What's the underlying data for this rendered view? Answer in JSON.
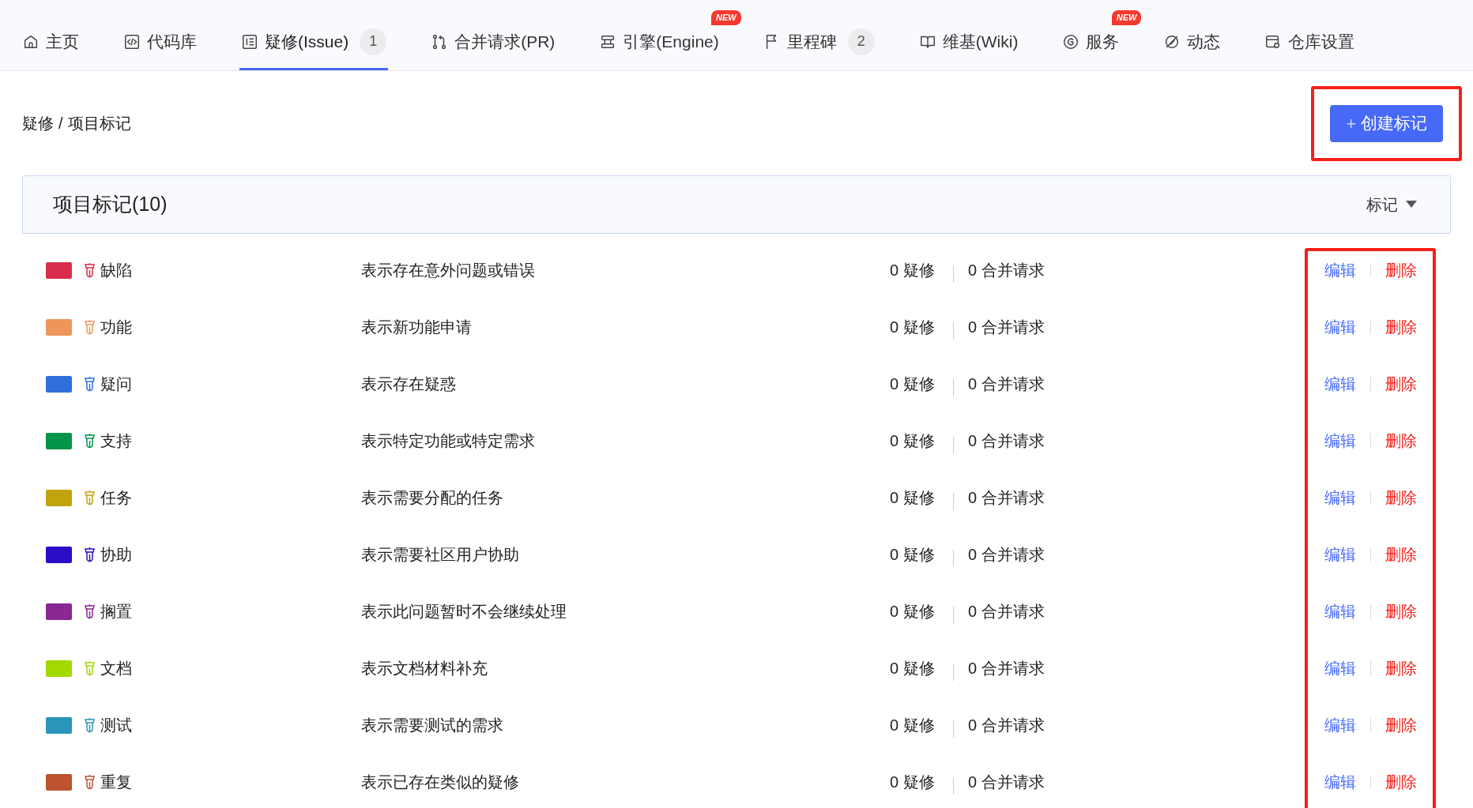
{
  "tabs": [
    {
      "kind": "home",
      "label": "主页",
      "selected": false
    },
    {
      "kind": "code",
      "label": "代码库",
      "selected": false
    },
    {
      "kind": "issue",
      "label": "疑修(Issue)",
      "badge": "1",
      "selected": true
    },
    {
      "kind": "pr",
      "label": "合并请求(PR)",
      "selected": false
    },
    {
      "kind": "engine",
      "label": "引擎(Engine)",
      "flag": "NEW",
      "selected": false
    },
    {
      "kind": "milestone",
      "label": "里程碑",
      "badge": "2",
      "selected": false
    },
    {
      "kind": "wiki",
      "label": "维基(Wiki)",
      "selected": false
    },
    {
      "kind": "service",
      "label": "服务",
      "flag": "NEW",
      "selected": false
    },
    {
      "kind": "activity",
      "label": "动态",
      "selected": false
    },
    {
      "kind": "settings",
      "label": "仓库设置",
      "selected": false
    }
  ],
  "breadcrumb": {
    "separator": "/",
    "items": [
      "疑修",
      "项目标记"
    ]
  },
  "create_button": {
    "icon": "+",
    "label": "创建标记"
  },
  "panel": {
    "title": "项目标记(10)",
    "sort": "标记"
  },
  "labels": [
    {
      "color": "#d92d4c",
      "name": "缺陷",
      "description": "表示存在意外问题或错误",
      "issues": "0 疑修",
      "prs": "0 合并请求",
      "edit": "编辑",
      "delete": "删除"
    },
    {
      "color": "#ee955a",
      "name": "功能",
      "description": "表示新功能申请",
      "issues": "0 疑修",
      "prs": "0 合并请求",
      "edit": "编辑",
      "delete": "删除"
    },
    {
      "color": "#2f6fdb",
      "name": "疑问",
      "description": "表示存在疑惑",
      "issues": "0 疑修",
      "prs": "0 合并请求",
      "edit": "编辑",
      "delete": "删除"
    },
    {
      "color": "#029448",
      "name": "支持",
      "description": "表示特定功能或特定需求",
      "issues": "0 疑修",
      "prs": "0 合并请求",
      "edit": "编辑",
      "delete": "删除"
    },
    {
      "color": "#c1a30d",
      "name": "任务",
      "description": "表示需要分配的任务",
      "issues": "0 疑修",
      "prs": "0 合并请求",
      "edit": "编辑",
      "delete": "删除"
    },
    {
      "color": "#2d0ec6",
      "name": "协助",
      "description": "表示需要社区用户协助",
      "issues": "0 疑修",
      "prs": "0 合并请求",
      "edit": "编辑",
      "delete": "删除"
    },
    {
      "color": "#892793",
      "name": "搁置",
      "description": "表示此问题暂时不会继续处理",
      "issues": "0 疑修",
      "prs": "0 合并请求",
      "edit": "编辑",
      "delete": "删除"
    },
    {
      "color": "#a2d901",
      "name": "文档",
      "description": "表示文档材料补充",
      "issues": "0 疑修",
      "prs": "0 合并请求",
      "edit": "编辑",
      "delete": "删除"
    },
    {
      "color": "#2a95ba",
      "name": "测试",
      "description": "表示需要测试的需求",
      "issues": "0 疑修",
      "prs": "0 合并请求",
      "edit": "编辑",
      "delete": "删除"
    },
    {
      "color": "#be532f",
      "name": "重复",
      "description": "表示已存在类似的疑修",
      "issues": "0 疑修",
      "prs": "0 合并请求",
      "edit": "编辑",
      "delete": "删除"
    }
  ]
}
